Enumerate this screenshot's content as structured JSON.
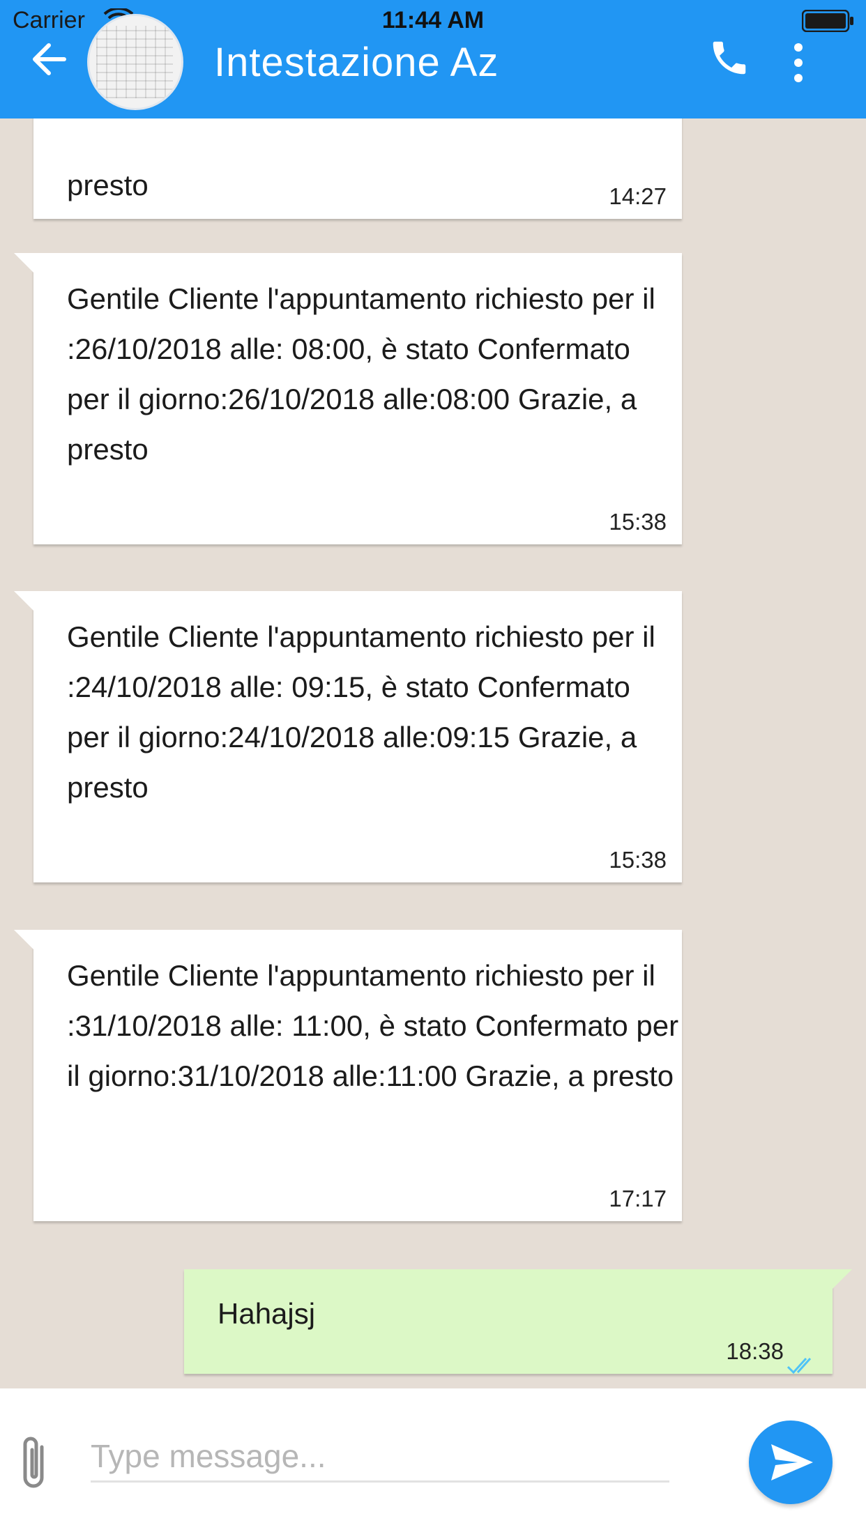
{
  "status_bar": {
    "carrier": "Carrier",
    "time": "11:44 AM"
  },
  "header": {
    "title": "Intestazione Az",
    "background_color": "#2196f3",
    "icons": [
      "arrow-back-icon",
      "contact-avatar",
      "phone-icon",
      "more-vert-icon"
    ]
  },
  "messages": [
    {
      "direction": "in",
      "text": "presto",
      "time": "14:27"
    },
    {
      "direction": "in",
      "text": "Gentile Cliente l'appuntamento richiesto per il :26/10/2018 alle: 08:00, è stato Confermato per il giorno:26/10/2018 alle:08:00 Grazie, a presto",
      "time": "15:38"
    },
    {
      "direction": "in",
      "text": "Gentile Cliente l'appuntamento richiesto per il :24/10/2018 alle: 09:15, è stato Confermato per il giorno:24/10/2018 alle:09:15 Grazie, a presto",
      "time": "15:38"
    },
    {
      "direction": "in",
      "text": "Gentile Cliente l'appuntamento richiesto per il :31/10/2018 alle: 11:00, è stato Confermato per il giorno:31/10/2018 alle:11:00 Grazie, a presto",
      "time": "17:17"
    },
    {
      "direction": "out",
      "text": "Hahajsj",
      "time": "18:38",
      "status": "read-double-check-icon"
    }
  ],
  "composer": {
    "placeholder": "Type message...",
    "value": "",
    "attach_icon": "paperclip-icon",
    "send_icon": "send-icon",
    "send_color": "#2196f3"
  },
  "colors": {
    "chat_background": "#e5ddd5",
    "incoming_bubble": "#ffffff",
    "outgoing_bubble": "#dcf8c6",
    "read_ticks": "#4fc3f7"
  }
}
